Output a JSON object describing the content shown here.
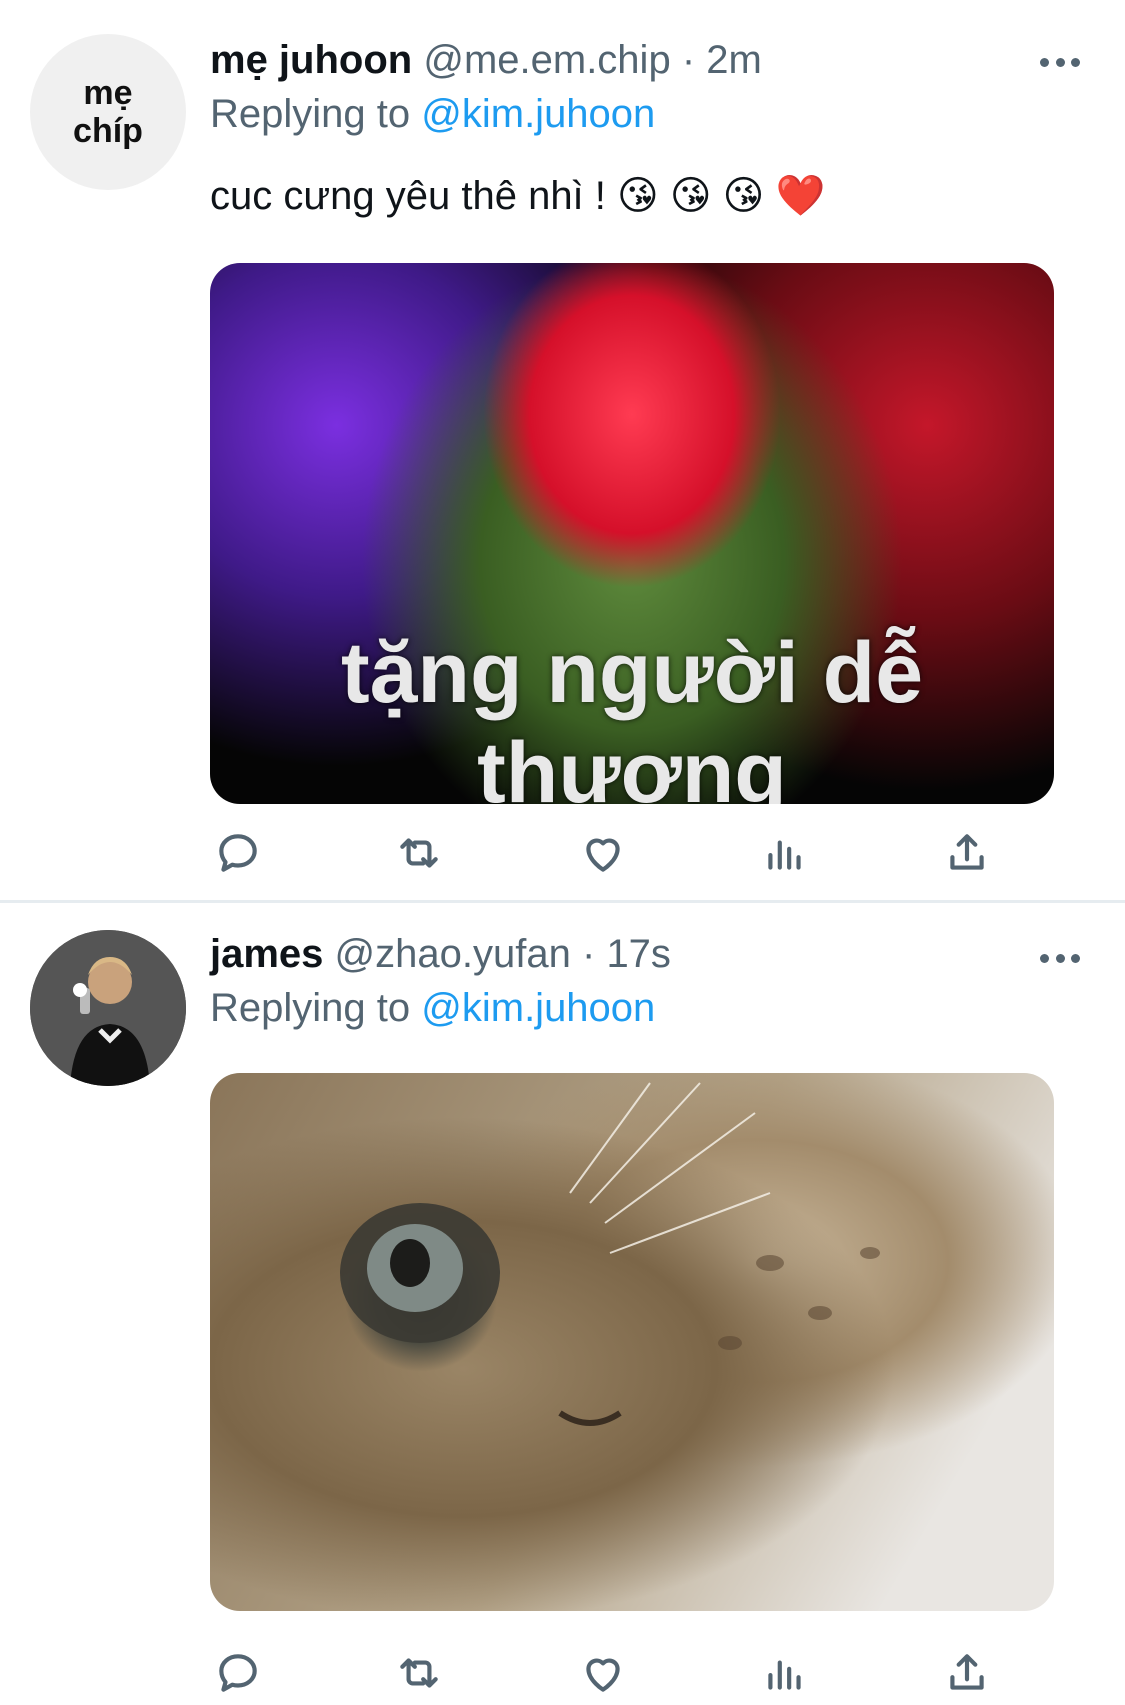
{
  "tweets": [
    {
      "avatar_text_line1": "mẹ",
      "avatar_text_line2": "chíp",
      "display_name": "mẹ juhoon",
      "handle": "@me.em.chip",
      "separator": "·",
      "time": "2m",
      "replying_prefix": "Replying to",
      "replying_to": "@kim.juhoon",
      "text": "cuc cưng yêu thê nhì ! 😘 😘 😘 ❤️",
      "media_caption": "tặng người dễ thương"
    },
    {
      "display_name": "james",
      "handle": "@zhao.yufan",
      "separator": "·",
      "time": "17s",
      "replying_prefix": "Replying to",
      "replying_to": "@kim.juhoon"
    }
  ],
  "icons": [
    "more-icon",
    "reply-icon",
    "retweet-icon",
    "like-icon",
    "stats-icon",
    "share-icon"
  ],
  "colors": {
    "accent": "#1d9bf0",
    "secondary_text": "#536471",
    "divider": "#e6ecf0"
  }
}
